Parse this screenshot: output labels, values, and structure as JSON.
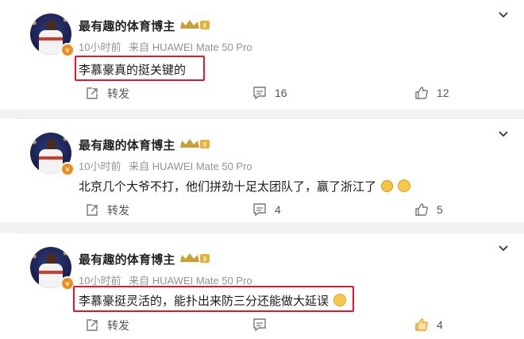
{
  "posts": [
    {
      "username": "最有趣的体育博主",
      "time": "10小时前",
      "source": "来自 HUAWEI Mate 50 Pro",
      "content": "李慕豪真的挺关键的",
      "highlighted": true,
      "emojis": [],
      "share_label": "转发",
      "comment_count": "16",
      "like_count": "12",
      "liked": false
    },
    {
      "username": "最有趣的体育博主",
      "time": "10小时前",
      "source": "来自 HUAWEI Mate 50 Pro",
      "content": "北京几个大爷不打，他们拼劲十足太团队了，赢了浙江了",
      "highlighted": false,
      "emojis": [
        "tiger-emoji",
        "smirk-emoji"
      ],
      "share_label": "转发",
      "comment_count": "4",
      "like_count": "5",
      "liked": false
    },
    {
      "username": "最有趣的体育博主",
      "time": "10小时前",
      "source": "来自 HUAWEI Mate 50 Pro",
      "content": "李慕豪挺灵活的，能扑出来防三分还能做大延误",
      "highlighted": true,
      "emojis": [
        "laugh-cry-emoji"
      ],
      "share_label": "转发",
      "comment_count": "",
      "like_count": "4",
      "liked": true
    }
  ],
  "colors": {
    "highlight_box": "#e0182d",
    "meta_text": "#939393",
    "liked_icon": "#f0a020",
    "verified_badge": "#f08b1d",
    "crown": "#c9a036"
  }
}
